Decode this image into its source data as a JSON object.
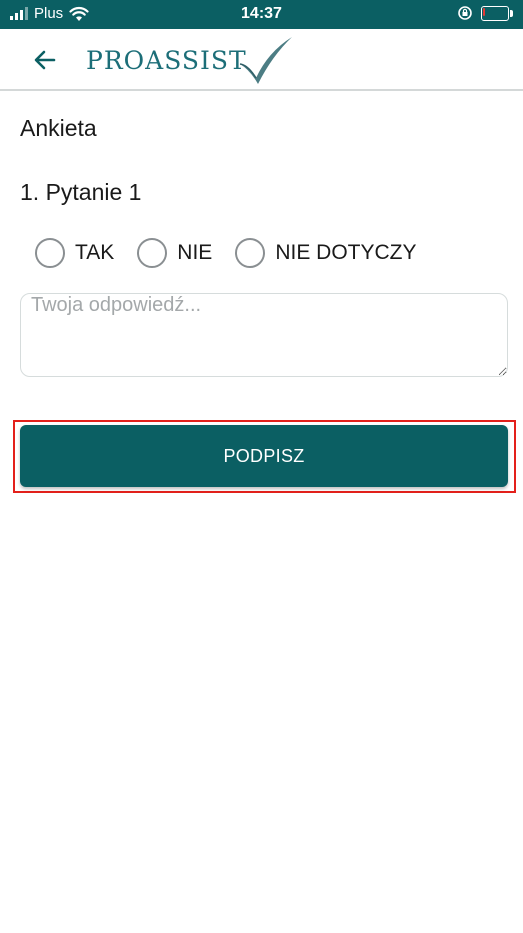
{
  "status_bar": {
    "carrier": "Plus",
    "time": "14:37",
    "battery_level": 0.1,
    "background_color": "#0b5f63"
  },
  "header": {
    "back_icon": "arrow-left-icon",
    "logo_text": "PROASSIST",
    "logo_icon": "checkmark-icon"
  },
  "page": {
    "title": "Ankieta"
  },
  "question": {
    "title": "1. Pytanie 1",
    "options": [
      "TAK",
      "NIE",
      "NIE DOTYCZY"
    ],
    "selected": null,
    "answer_value": "",
    "answer_placeholder": "Twoja odpowiedź..."
  },
  "actions": {
    "sign_label": "PODPISZ",
    "accent_color": "#0b5f63",
    "highlight_color": "#e3201b"
  }
}
